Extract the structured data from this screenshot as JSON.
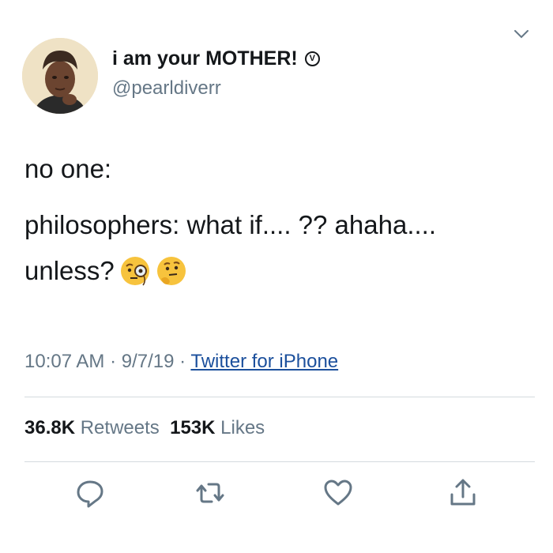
{
  "tweet": {
    "display_name": "i am your MOTHER!",
    "verified_badge_glyph": "V",
    "handle": "@pearldiverr",
    "text_line_1": "no one:",
    "text_line_2": "philosophers: what if.... ?? ahaha....",
    "text_line_3": "unless?",
    "emojis": [
      "face-with-monocle-icon",
      "thinking-face-icon"
    ],
    "time": "10:07 AM",
    "date": "9/7/19",
    "source": "Twitter for iPhone",
    "separator": "·"
  },
  "stats": {
    "retweets_count": "36.8K",
    "retweets_label": "Retweets",
    "likes_count": "153K",
    "likes_label": "Likes"
  },
  "actions": [
    "reply-icon",
    "retweet-icon",
    "like-icon",
    "share-icon"
  ],
  "colors": {
    "text": "#14171a",
    "secondary": "#657786",
    "link": "#1b4f9c",
    "divider": "#d4dade",
    "emoji": "#f7c33d"
  }
}
